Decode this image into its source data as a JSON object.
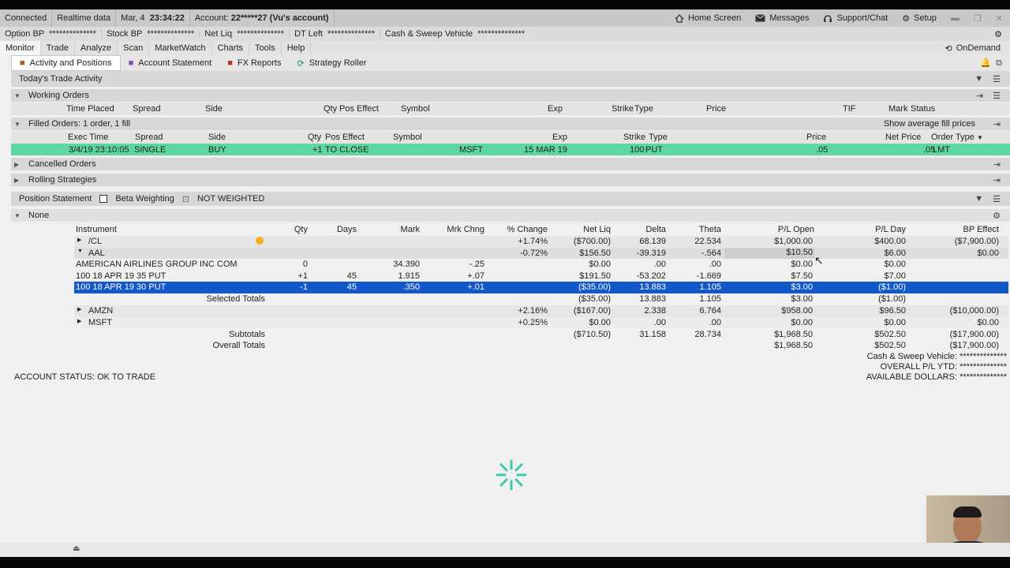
{
  "status_bar": {
    "connected": "Connected",
    "data": "Realtime data",
    "date": "Mar, 4",
    "time": "23:34:22",
    "account_label": "Account:",
    "account": "22*****27 (Vu's account)",
    "home": "Home Screen",
    "messages": "Messages",
    "support": "Support/Chat",
    "setup": "Setup"
  },
  "balances": [
    {
      "label": "Option BP",
      "value": "**************"
    },
    {
      "label": "Stock BP",
      "value": "**************"
    },
    {
      "label": "Net Liq",
      "value": "**************"
    },
    {
      "label": "DT Left",
      "value": "**************"
    },
    {
      "label": "Cash & Sweep Vehicle",
      "value": "**************"
    }
  ],
  "menu": [
    "Monitor",
    "Trade",
    "Analyze",
    "Scan",
    "MarketWatch",
    "Charts",
    "Tools",
    "Help"
  ],
  "ondemand": "OnDemand",
  "subtabs": [
    "Activity and Positions",
    "Account Statement",
    "FX Reports",
    "Strategy Roller"
  ],
  "todays_trade_activity": "Today's Trade Activity",
  "working_orders": {
    "title": "Working Orders",
    "headers": [
      "Time Placed",
      "Spread",
      "Side",
      "Qty",
      "Pos Effect",
      "Symbol",
      "Exp",
      "Strike",
      "Type",
      "Price",
      "TIF",
      "Mark",
      "Status"
    ]
  },
  "filled_orders": {
    "title": "Filled Orders: 1 order, 1 fill",
    "show_avg": "Show average fill prices",
    "headers": [
      "Exec Time",
      "Spread",
      "Side",
      "Qty",
      "Pos Effect",
      "Symbol",
      "Exp",
      "Strike",
      "Type",
      "Price",
      "Net Price",
      "Order Type"
    ],
    "row": {
      "exec_time": "3/4/19 23:10:05",
      "spread": "SINGLE",
      "side": "BUY",
      "qty": "+1",
      "pos_effect": "TO CLOSE",
      "symbol": "MSFT",
      "exp": "15 MAR 19",
      "strike": "100",
      "type": "PUT",
      "price": ".05",
      "net_price": ".05",
      "order_type": "LMT"
    }
  },
  "cancelled_orders": "Cancelled Orders",
  "rolling_strategies": "Rolling Strategies",
  "position_statement": {
    "title": "Position Statement",
    "beta": "Beta Weighting",
    "weighted": "NOT WEIGHTED",
    "group": "None",
    "headers": [
      "Instrument",
      "Qty",
      "Days",
      "Mark",
      "Mrk Chng",
      "% Change",
      "Net Liq",
      "Delta",
      "Theta",
      "P/L Open",
      "P/L Day",
      "BP Effect"
    ],
    "rows": [
      {
        "instrument": "/CL",
        "qty": "",
        "days": "",
        "mark": "",
        "mrk_chng": "",
        "pct": "+1.74%",
        "net_liq": "($700.00)",
        "delta": "68.139",
        "theta": "22.534",
        "pl_open": "$1,000.00",
        "pl_day": "$400.00",
        "bp": "($7,900.00)"
      },
      {
        "instrument": "AAL",
        "qty": "",
        "days": "",
        "mark": "",
        "mrk_chng": "",
        "pct": "-0.72%",
        "net_liq": "$156.50",
        "delta": "-39.319",
        "theta": "-.564",
        "pl_open": "$10.50",
        "pl_day": "$6.00",
        "bp": "$0.00"
      },
      {
        "instrument": "AMERICAN AIRLINES GROUP INC COM",
        "qty": "0",
        "days": "",
        "mark": "34.390",
        "mrk_chng": "-.25",
        "pct": "",
        "net_liq": "$0.00",
        "delta": ".00",
        "theta": ".00",
        "pl_open": "$0.00",
        "pl_day": "$0.00",
        "bp": ""
      },
      {
        "instrument": "100 18 APR 19 35 PUT",
        "qty": "+1",
        "days": "45",
        "mark": "1.915",
        "mrk_chng": "+.07",
        "pct": "",
        "net_liq": "$191.50",
        "delta": "-53.202",
        "theta": "-1.669",
        "pl_open": "$7.50",
        "pl_day": "$7.00",
        "bp": ""
      },
      {
        "instrument": "100 18 APR 19 30 PUT",
        "qty": "-1",
        "days": "45",
        "mark": ".350",
        "mrk_chng": "+.01",
        "pct": "",
        "net_liq": "($35.00)",
        "delta": "13.883",
        "theta": "1.105",
        "pl_open": "$3.00",
        "pl_day": "($1.00)",
        "bp": ""
      },
      {
        "instrument": "Selected Totals",
        "qty": "",
        "days": "",
        "mark": "",
        "mrk_chng": "",
        "pct": "",
        "net_liq": "($35.00)",
        "delta": "13.883",
        "theta": "1.105",
        "pl_open": "$3.00",
        "pl_day": "($1.00)",
        "bp": ""
      },
      {
        "instrument": "AMZN",
        "qty": "",
        "days": "",
        "mark": "",
        "mrk_chng": "",
        "pct": "+2.16%",
        "net_liq": "($167.00)",
        "delta": "2.338",
        "theta": "6.764",
        "pl_open": "$958.00",
        "pl_day": "$96.50",
        "bp": "($10,000.00)"
      },
      {
        "instrument": "MSFT",
        "qty": "",
        "days": "",
        "mark": "",
        "mrk_chng": "",
        "pct": "+0.25%",
        "net_liq": "$0.00",
        "delta": ".00",
        "theta": ".00",
        "pl_open": "$0.00",
        "pl_day": "$0.00",
        "bp": "$0.00"
      }
    ],
    "subtotals": {
      "label": "Subtotals",
      "net_liq": "($710.50)",
      "delta": "31.158",
      "theta": "28.734",
      "pl_open": "$1,968.50",
      "pl_day": "$502.50",
      "bp": "($17,900.00)"
    },
    "overall": {
      "label": "Overall Totals",
      "pl_open": "$1,968.50",
      "pl_day": "$502.50",
      "bp": "($17,900.00)"
    }
  },
  "summary": [
    {
      "label": "Cash & Sweep Vehicle:",
      "value": "**************"
    },
    {
      "label": "OVERALL P/L YTD:",
      "value": "**************"
    },
    {
      "label": "AVAILABLE DOLLARS:",
      "value": "**************"
    }
  ],
  "account_status": "ACCOUNT STATUS: OK TO TRADE",
  "colors": {
    "filled_row": "#5ed6a0",
    "selected_row": "#1457c8",
    "loading": "#3cc9a8"
  }
}
